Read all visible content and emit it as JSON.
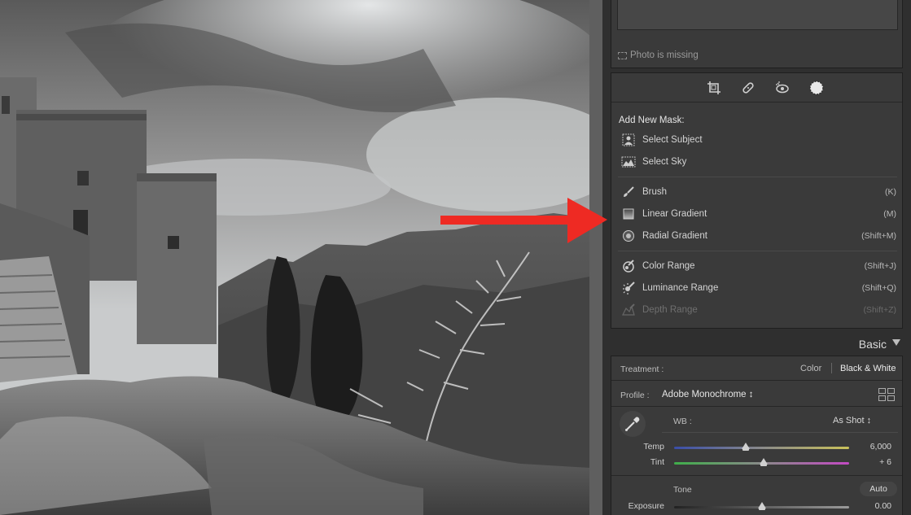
{
  "navigator": {
    "missing_text": "Photo is missing"
  },
  "toolstrip": {
    "tools": [
      {
        "name": "crop-icon"
      },
      {
        "name": "healing-icon"
      },
      {
        "name": "redeye-icon"
      },
      {
        "name": "masking-icon"
      }
    ]
  },
  "masks": {
    "title": "Add New Mask:",
    "items": [
      {
        "label": "Select Subject",
        "key": "",
        "icon": "person-icon"
      },
      {
        "label": "Select Sky",
        "key": "",
        "icon": "sky-icon"
      },
      {
        "label": "Brush",
        "key": "(K)",
        "icon": "brush-icon"
      },
      {
        "label": "Linear Gradient",
        "key": "(M)",
        "icon": "linear-gradient-icon"
      },
      {
        "label": "Radial Gradient",
        "key": "(Shift+M)",
        "icon": "radial-gradient-icon"
      },
      {
        "label": "Color Range",
        "key": "(Shift+J)",
        "icon": "color-range-icon"
      },
      {
        "label": "Luminance Range",
        "key": "(Shift+Q)",
        "icon": "luminance-range-icon"
      },
      {
        "label": "Depth Range",
        "key": "(Shift+Z)",
        "icon": "depth-range-icon",
        "disabled": true
      }
    ]
  },
  "basic": {
    "title": "Basic",
    "treatment_label": "Treatment :",
    "treatment_color": "Color",
    "treatment_bw": "Black & White",
    "profile_label": "Profile :",
    "profile_value": "Adobe Monochrome ↕",
    "wb_label": "WB :",
    "wb_value": "As Shot ↕",
    "temp": {
      "label": "Temp",
      "value": "6,000",
      "position": 0.41
    },
    "tint": {
      "label": "Tint",
      "value": "+ 6",
      "position": 0.51
    },
    "tone_label": "Tone",
    "auto_label": "Auto",
    "exposure": {
      "label": "Exposure",
      "value": "0.00",
      "position": 0.5
    }
  },
  "colors": {
    "annotation_arrow": "#ee2a23",
    "panel_bg": "#3a3a3a"
  }
}
